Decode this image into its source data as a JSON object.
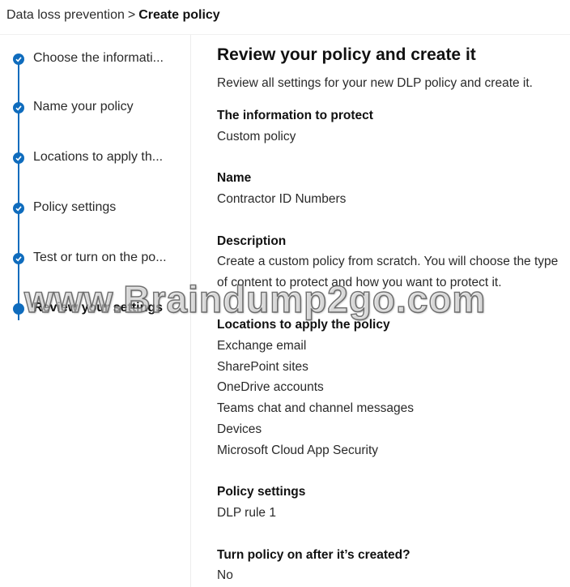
{
  "breadcrumb": {
    "parent": "Data loss prevention",
    "separator": ">",
    "current": "Create policy"
  },
  "wizard": {
    "steps": [
      {
        "label": "Choose the informati...",
        "status": "completed"
      },
      {
        "label": "Name your policy",
        "status": "completed"
      },
      {
        "label": "Locations to apply th...",
        "status": "completed"
      },
      {
        "label": "Policy settings",
        "status": "completed"
      },
      {
        "label": "Test or turn on the po...",
        "status": "completed"
      },
      {
        "label": "Review your settings",
        "status": "current"
      }
    ]
  },
  "review": {
    "title": "Review your policy and create it",
    "subtitle": "Review all settings for your new DLP policy and create it.",
    "info_heading": "The information to protect",
    "info_value": "Custom policy",
    "name_heading": "Name",
    "name_value": "Contractor ID Numbers",
    "description_heading": "Description",
    "description_value": "Create a custom policy from scratch. You will choose the type of content to protect and how you want to protect it.",
    "locations_heading": "Locations to apply the policy",
    "locations": [
      "Exchange email",
      "SharePoint sites",
      "OneDrive accounts",
      "Teams chat and channel messages",
      "Devices",
      "Microsoft Cloud App Security"
    ],
    "settings_heading": "Policy settings",
    "settings_value": "DLP rule 1",
    "turn_on_heading": "Turn policy on after it’s created?",
    "turn_on_value": "No"
  },
  "watermark": "www.Braindump2go.com",
  "colors": {
    "accent": "#0f6cbd",
    "text": "#1f1f1f"
  }
}
